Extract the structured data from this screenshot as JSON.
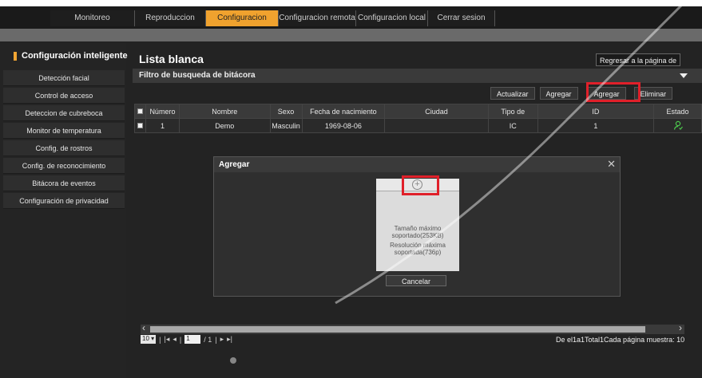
{
  "nav": {
    "tabs": [
      "Monitoreo",
      "Reproduccion",
      "Configuracion",
      "Configuracion remota",
      "Configuracion local",
      "Cerrar sesion"
    ]
  },
  "sidebar": {
    "title": "Configuración inteligente",
    "items": [
      "Detección facial",
      "Control de acceso",
      "Deteccion de cubreboca",
      "Monitor de temperatura",
      "Config. de rostros",
      "Config. de reconocimiento",
      "Bitácora de eventos",
      "Configuración de privacidad"
    ]
  },
  "page": {
    "title": "Lista blanca",
    "back_button": "Regresar a la página de",
    "filter_title": "Filtro de busqueda de bitácora"
  },
  "actions": {
    "refresh": "Actualizar",
    "add": "Agregar",
    "add2": "Agregar",
    "delete": "Eliminar"
  },
  "table": {
    "headers": [
      "Número",
      "Nombre",
      "Sexo",
      "Fecha de nacimiento",
      "Ciudad",
      "Tipo de",
      "ID",
      "Estado"
    ],
    "rows": [
      {
        "num": "1",
        "name": "Demo",
        "sex": "Masculin",
        "birth": "1969-08-06",
        "city": "",
        "type": "IC",
        "id": "1"
      }
    ]
  },
  "modal": {
    "title": "Agregar",
    "max_size": "Tamaño máximo soportado(253KB)",
    "max_resolution": "Resolución máxima soportada(736p)",
    "cancel": "Cancelar"
  },
  "pager": {
    "page_size": "10",
    "page_input": "1",
    "total_pages": "/ 1",
    "status": "De el1a1Total1Cada página muestra: 10"
  },
  "colors": {
    "accent": "#f0a22e",
    "highlight": "#e0202a",
    "status_ok": "#4cc84c"
  }
}
